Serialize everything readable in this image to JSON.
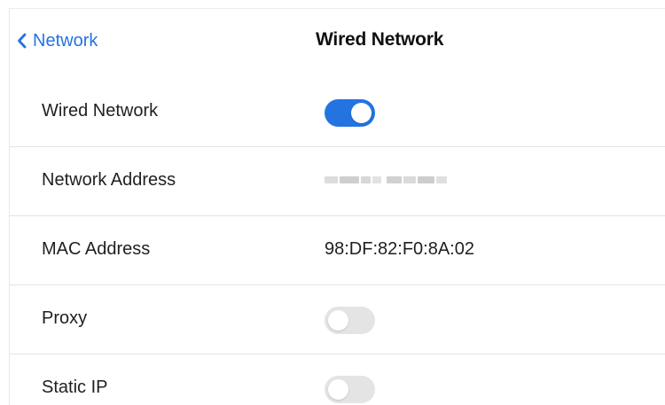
{
  "header": {
    "back_label": "Network",
    "title": "Wired Network"
  },
  "rows": [
    {
      "label": "Wired Network",
      "type": "toggle",
      "on": true
    },
    {
      "label": "Network Address",
      "type": "blurred"
    },
    {
      "label": "MAC Address",
      "type": "text",
      "value": "98:DF:82:F0:8A:02"
    },
    {
      "label": "Proxy",
      "type": "toggle",
      "on": false
    },
    {
      "label": "Static IP",
      "type": "toggle",
      "on": false
    }
  ],
  "colors": {
    "accent": "#2374e1",
    "toggle_off": "#e4e4e4",
    "divider": "#e4e4e4"
  },
  "icons": {
    "back": "chevron-left-icon"
  }
}
